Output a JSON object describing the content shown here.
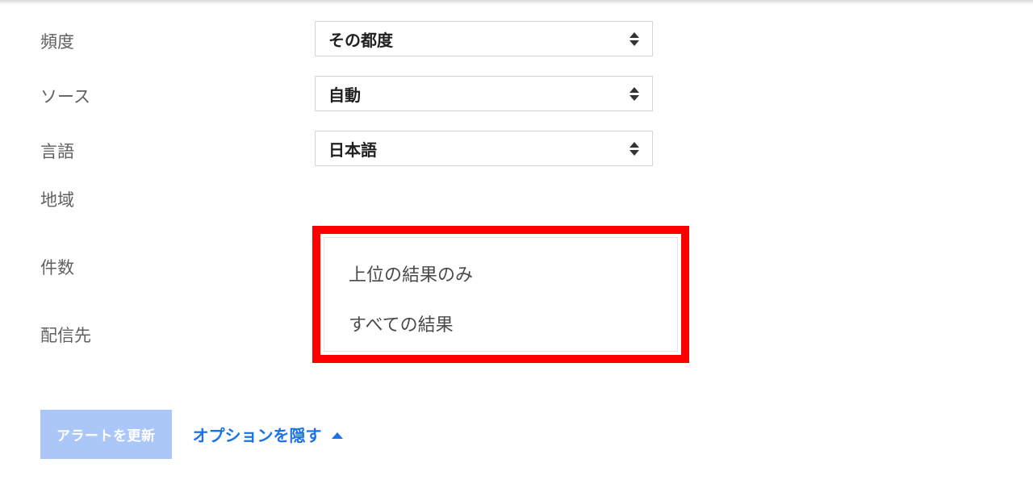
{
  "fields": {
    "frequency": {
      "label": "頻度",
      "value": "その都度"
    },
    "source": {
      "label": "ソース",
      "value": "自動"
    },
    "language": {
      "label": "言語",
      "value": "日本語"
    },
    "region": {
      "label": "地域"
    },
    "count": {
      "label": "件数"
    },
    "destination": {
      "label": "配信先",
      "value": ""
    }
  },
  "dropdown": {
    "options": [
      "上位の結果のみ",
      "すべての結果"
    ]
  },
  "footer": {
    "update_button": "アラートを更新",
    "hide_options": "オプションを隠す"
  }
}
